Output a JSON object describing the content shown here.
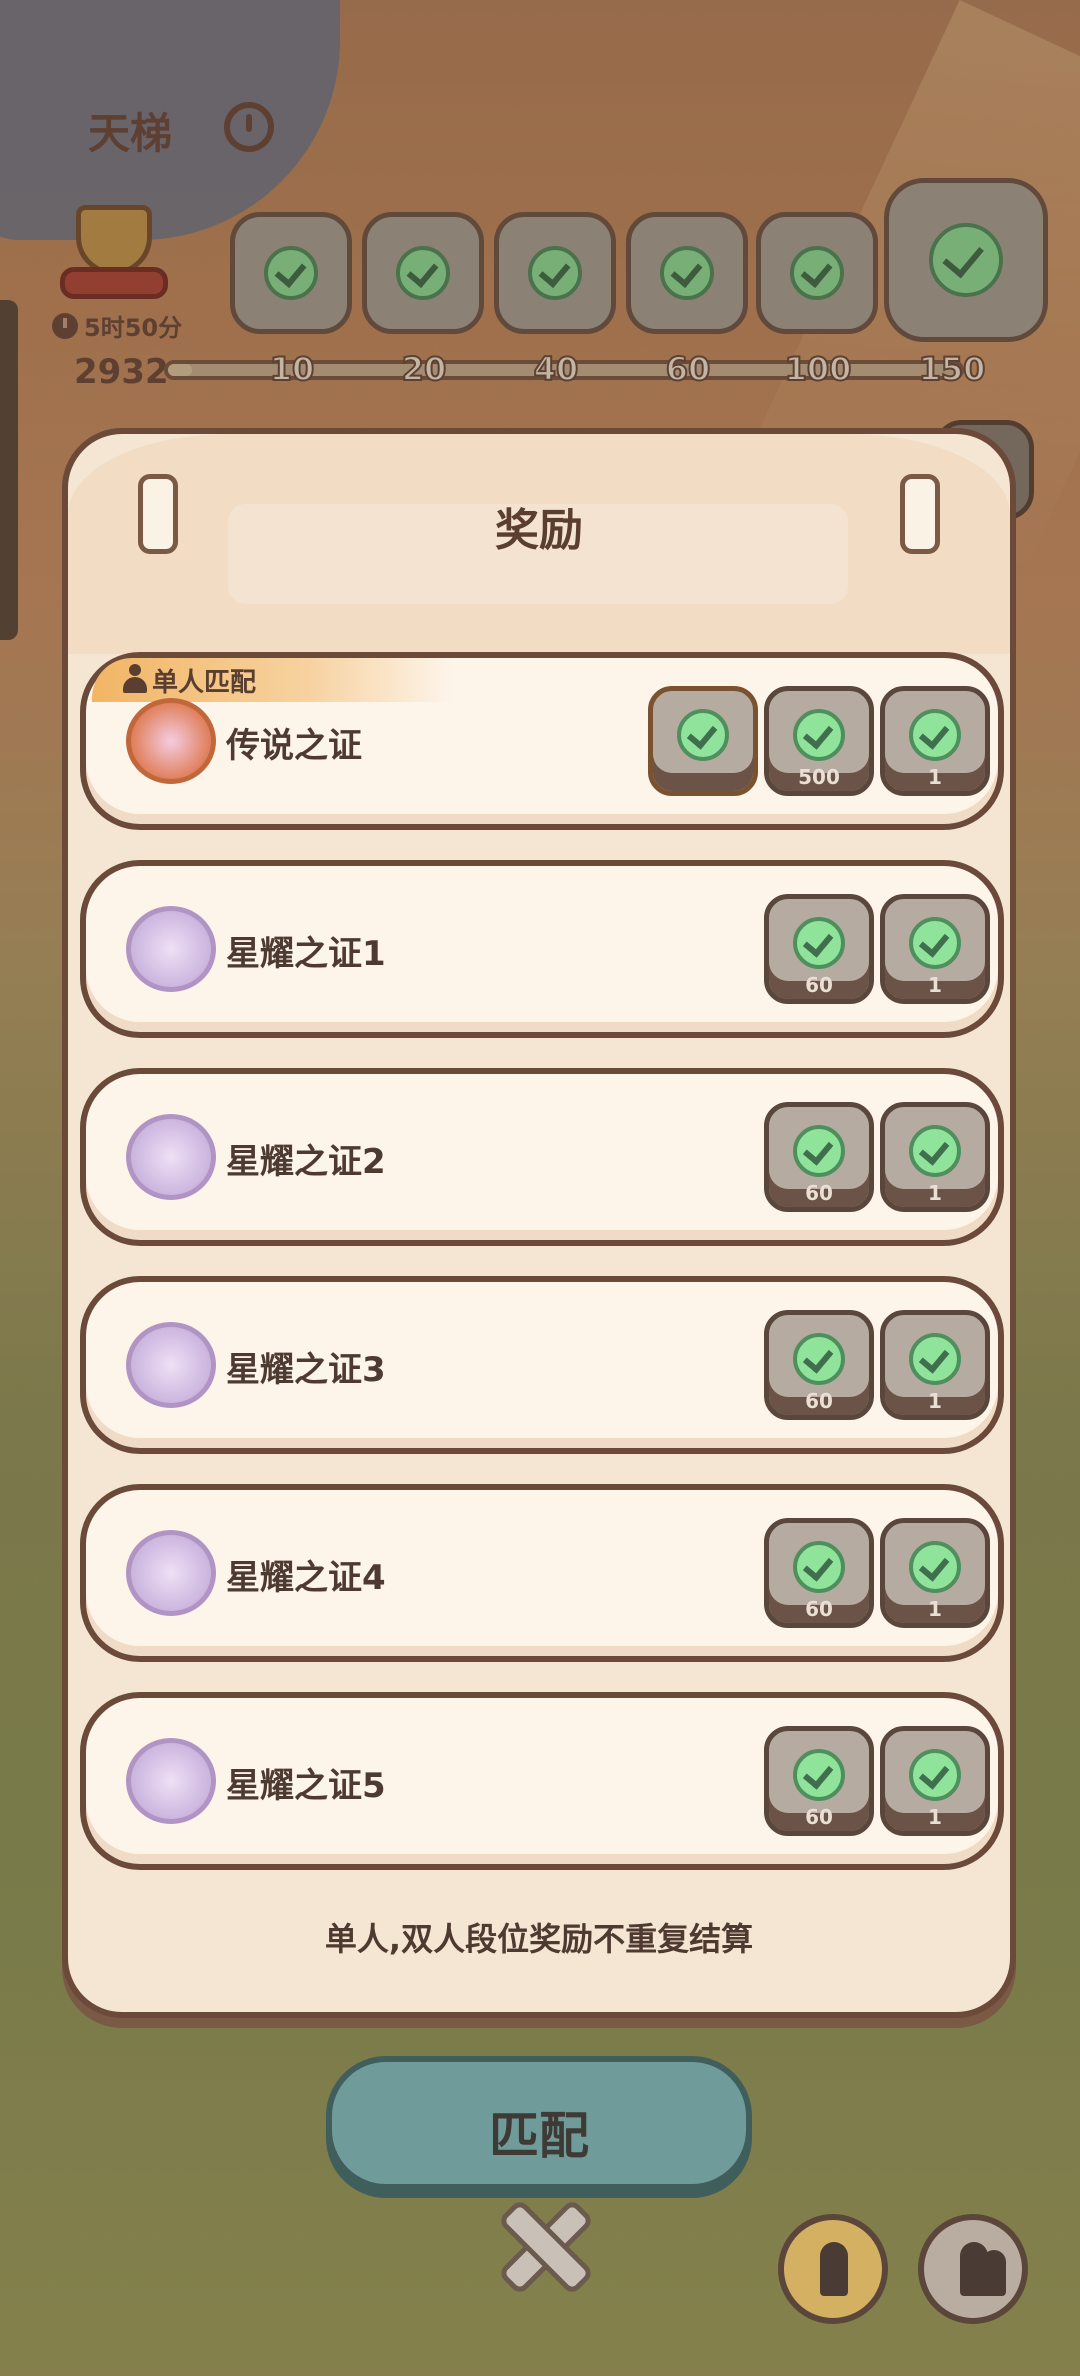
{
  "ladder": {
    "title": "天梯",
    "timer": "5时50分",
    "score": "2932",
    "progress_fraction": 0.03,
    "milestones": [
      "10",
      "20",
      "40",
      "60",
      "100",
      "150"
    ]
  },
  "modal": {
    "title": "奖励",
    "single_tag": "单人匹配",
    "rows": [
      {
        "name": "传说之证",
        "rewards": [
          {
            "count": ""
          },
          {
            "count": "500"
          },
          {
            "count": "1"
          }
        ]
      },
      {
        "name": "星耀之证1",
        "rewards": [
          {
            "count": "60"
          },
          {
            "count": "1"
          }
        ]
      },
      {
        "name": "星耀之证2",
        "rewards": [
          {
            "count": "60"
          },
          {
            "count": "1"
          }
        ]
      },
      {
        "name": "星耀之证3",
        "rewards": [
          {
            "count": "60"
          },
          {
            "count": "1"
          }
        ]
      },
      {
        "name": "星耀之证4",
        "rewards": [
          {
            "count": "60"
          },
          {
            "count": "1"
          }
        ]
      },
      {
        "name": "星耀之证5",
        "rewards": [
          {
            "count": "60"
          },
          {
            "count": "1"
          }
        ]
      }
    ],
    "note": "单人,双人段位奖励不重复结算"
  },
  "bottom": {
    "match_label": "匹配"
  },
  "colors": {
    "modal_bg": "#f5e6d4",
    "outline": "#6b4a3a",
    "check": "#8fe39a",
    "match_button": "#6f9c9a"
  },
  "icons": {
    "info": "info-icon",
    "trophy": "trophy-icon",
    "clock": "clock-icon",
    "check": "check-icon",
    "close": "close-icon",
    "solo": "solo-mode-icon",
    "duo": "duo-mode-icon"
  }
}
